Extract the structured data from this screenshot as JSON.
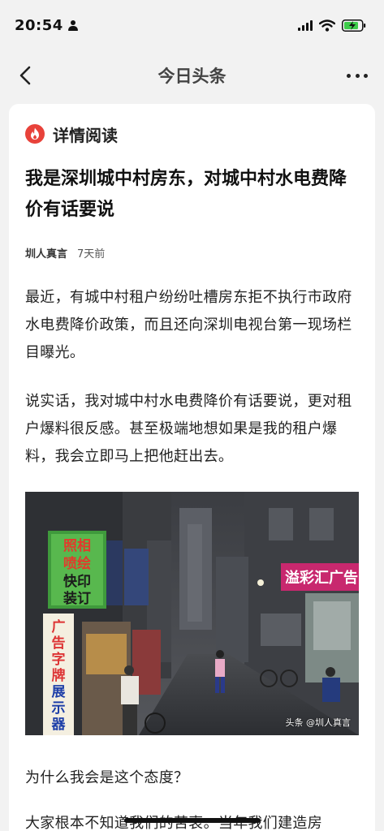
{
  "status": {
    "time": "20:54"
  },
  "nav": {
    "title": "今日头条"
  },
  "section": {
    "title": "详情阅读"
  },
  "article": {
    "title": "我是深圳城中村房东，对城中村水电费降价有话要说",
    "author": "圳人真言",
    "time": "7天前",
    "paragraphs": [
      "最近，有城中村租户纷纷吐槽房东拒不执行市政府水电费降价政策，而且还向深圳电视台第一现场栏目曝光。",
      "说实话，我对城中村水电费降价有话要说，更对租户爆料很反感。甚至极端地想如果是我的租户爆料，我会立即马上把他赶出去。",
      "为什么我会是这个态度？",
      "大家根本不知道我们的苦衷。当年我们建造房"
    ],
    "photo": {
      "watermark": "头条 @圳人真言",
      "signs": {
        "left_sign": "照相喷绘快印装订",
        "vertical_sign": "广告字牌展示器材",
        "right_sign": "溢彩汇广告"
      }
    }
  },
  "colors": {
    "accent_red": "#e8423a",
    "background": "#f2f2f2",
    "card": "#ffffff"
  }
}
